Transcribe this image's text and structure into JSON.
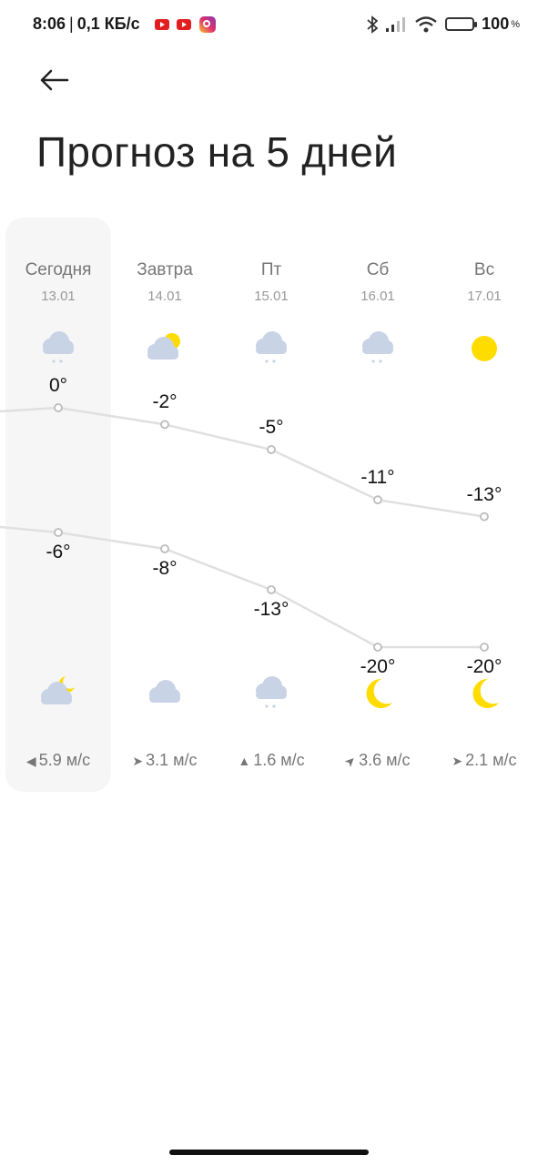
{
  "status_bar": {
    "time": "8:06",
    "net_speed": "0,1 КБ/с",
    "battery_percent": "100",
    "battery_unit": "%",
    "battery_color": "#f4b63e"
  },
  "header": {
    "back_icon": "arrow-left-icon",
    "title": "Прогноз на 5 дней"
  },
  "colors": {
    "card_bg": "#f6f6f6",
    "cloud": "#c9d3e6",
    "sun": "#ffdc00",
    "line": "#e0e0e0"
  },
  "days": [
    {
      "name": "Сегодня",
      "date": "13.01",
      "day_icon": "cloud-snow-icon",
      "night_icon": "partly-cloudy-night-icon",
      "high": "0°",
      "low": "-6°",
      "high_value": 0,
      "low_value": -6,
      "wind": "5.9 м/с",
      "wind_dir_icon": "wind-arrow-west-icon",
      "wind_arrow": "◀",
      "wind_deg": 0
    },
    {
      "name": "Завтра",
      "date": "14.01",
      "day_icon": "partly-cloudy-day-icon",
      "night_icon": "cloud-icon",
      "high": "-2°",
      "low": "-8°",
      "high_value": -2,
      "low_value": -8,
      "wind": "3.1 м/с",
      "wind_dir_icon": "wind-arrow-east-icon",
      "wind_arrow": "➤",
      "wind_deg": 0
    },
    {
      "name": "Пт",
      "date": "15.01",
      "day_icon": "cloud-snow-icon",
      "night_icon": "cloud-snow-icon",
      "high": "-5°",
      "low": "-13°",
      "high_value": -5,
      "low_value": -13,
      "wind": "1.6 м/с",
      "wind_dir_icon": "wind-arrow-north-icon",
      "wind_arrow": "▲",
      "wind_deg": 0
    },
    {
      "name": "Сб",
      "date": "16.01",
      "day_icon": "cloud-snow-icon",
      "night_icon": "moon-icon",
      "high": "-11°",
      "low": "-20°",
      "high_value": -11,
      "low_value": -20,
      "wind": "3.6 м/с",
      "wind_dir_icon": "wind-arrow-northeast-icon",
      "wind_arrow": "➤",
      "wind_deg": -45
    },
    {
      "name": "Вс",
      "date": "17.01",
      "day_icon": "sun-icon",
      "night_icon": "moon-icon",
      "high": "-13°",
      "low": "-20°",
      "high_value": -13,
      "low_value": -20,
      "wind": "2.1 м/с",
      "wind_dir_icon": "wind-arrow-east-icon",
      "wind_arrow": "➤",
      "wind_deg": 0
    }
  ],
  "chart_data": {
    "type": "line",
    "categories": [
      "Сегодня",
      "Завтра",
      "Пт",
      "Сб",
      "Вс"
    ],
    "series": [
      {
        "values": [
          0,
          -2,
          -5,
          -11,
          -13
        ]
      },
      {
        "values": [
          -6,
          -8,
          -13,
          -20,
          -20
        ]
      }
    ],
    "grid": false
  }
}
